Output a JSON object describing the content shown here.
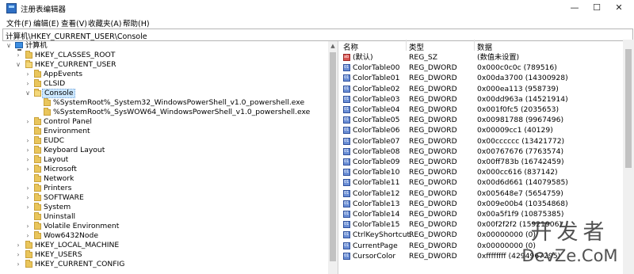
{
  "window": {
    "title": "注册表编辑器",
    "minimize": "—",
    "maximize": "☐",
    "close": "✕"
  },
  "menu": [
    "文件(F)",
    "编辑(E)",
    "查看(V)",
    "收藏夹(A)",
    "帮助(H)"
  ],
  "address": "计算机\\HKEY_CURRENT_USER\\Console",
  "tree": {
    "root": "计算机",
    "hkcr": "HKEY_CLASSES_ROOT",
    "hkcu": "HKEY_CURRENT_USER",
    "appevents": "AppEvents",
    "clsid": "CLSID",
    "console": "Console",
    "ps32": "%SystemRoot%_System32_WindowsPowerShell_v1.0_powershell.exe",
    "pswow": "%SystemRoot%_SysWOW64_WindowsPowerShell_v1.0_powershell.exe",
    "controlpanel": "Control Panel",
    "environment": "Environment",
    "eudc": "EUDC",
    "keyboard": "Keyboard Layout",
    "layout": "Layout",
    "microsoft": "Microsoft",
    "network": "Network",
    "printers": "Printers",
    "software": "SOFTWARE",
    "system": "System",
    "uninstall": "Uninstall",
    "volatile": "Volatile Environment",
    "wow6432": "Wow6432Node",
    "hklm": "HKEY_LOCAL_MACHINE",
    "hku": "HKEY_USERS",
    "hkcc": "HKEY_CURRENT_CONFIG"
  },
  "columns": {
    "name": "名称",
    "type": "类型",
    "data": "数据"
  },
  "values": [
    {
      "icon": "string-value-icon",
      "name": "(默认)",
      "type": "REG_SZ",
      "data": "(数值未设置)"
    },
    {
      "icon": "binary-value-icon",
      "name": "ColorTable00",
      "type": "REG_DWORD",
      "data": "0x000c0c0c (789516)"
    },
    {
      "icon": "binary-value-icon",
      "name": "ColorTable01",
      "type": "REG_DWORD",
      "data": "0x00da3700 (14300928)"
    },
    {
      "icon": "binary-value-icon",
      "name": "ColorTable02",
      "type": "REG_DWORD",
      "data": "0x000ea113 (958739)"
    },
    {
      "icon": "binary-value-icon",
      "name": "ColorTable03",
      "type": "REG_DWORD",
      "data": "0x00dd963a (14521914)"
    },
    {
      "icon": "binary-value-icon",
      "name": "ColorTable04",
      "type": "REG_DWORD",
      "data": "0x001f0fc5 (2035653)"
    },
    {
      "icon": "binary-value-icon",
      "name": "ColorTable05",
      "type": "REG_DWORD",
      "data": "0x00981788 (9967496)"
    },
    {
      "icon": "binary-value-icon",
      "name": "ColorTable06",
      "type": "REG_DWORD",
      "data": "0x00009cc1 (40129)"
    },
    {
      "icon": "binary-value-icon",
      "name": "ColorTable07",
      "type": "REG_DWORD",
      "data": "0x00cccccc (13421772)"
    },
    {
      "icon": "binary-value-icon",
      "name": "ColorTable08",
      "type": "REG_DWORD",
      "data": "0x00767676 (7763574)"
    },
    {
      "icon": "binary-value-icon",
      "name": "ColorTable09",
      "type": "REG_DWORD",
      "data": "0x00ff783b (16742459)"
    },
    {
      "icon": "binary-value-icon",
      "name": "ColorTable10",
      "type": "REG_DWORD",
      "data": "0x000cc616 (837142)"
    },
    {
      "icon": "binary-value-icon",
      "name": "ColorTable11",
      "type": "REG_DWORD",
      "data": "0x00d6d661 (14079585)"
    },
    {
      "icon": "binary-value-icon",
      "name": "ColorTable12",
      "type": "REG_DWORD",
      "data": "0x005648e7 (5654759)"
    },
    {
      "icon": "binary-value-icon",
      "name": "ColorTable13",
      "type": "REG_DWORD",
      "data": "0x009e00b4 (10354868)"
    },
    {
      "icon": "binary-value-icon",
      "name": "ColorTable14",
      "type": "REG_DWORD",
      "data": "0x00a5f1f9 (10875385)"
    },
    {
      "icon": "binary-value-icon",
      "name": "ColorTable15",
      "type": "REG_DWORD",
      "data": "0x00f2f2f2 (15921906)"
    },
    {
      "icon": "binary-value-icon",
      "name": "CtrlKeyShortcut...",
      "type": "REG_DWORD",
      "data": "0x00000000 (0)"
    },
    {
      "icon": "binary-value-icon",
      "name": "CurrentPage",
      "type": "REG_DWORD",
      "data": "0x00000000 (0)"
    },
    {
      "icon": "binary-value-icon",
      "name": "CursorColor",
      "type": "REG_DWORD",
      "data": "0xffffffff (4294967295)"
    }
  ],
  "watermark": {
    "line1": "开发者",
    "line2": "DevZe.CoM"
  }
}
